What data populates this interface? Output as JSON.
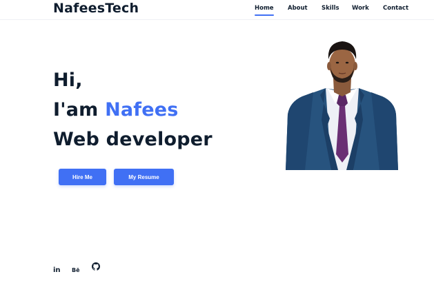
{
  "brand": {
    "logo_text": "NafeesTech"
  },
  "nav": {
    "items": [
      {
        "label": "Home",
        "active": true
      },
      {
        "label": "About",
        "active": false
      },
      {
        "label": "Skills",
        "active": false
      },
      {
        "label": "Work",
        "active": false
      },
      {
        "label": "Contact",
        "active": false
      }
    ]
  },
  "hero": {
    "greeting": "Hi,",
    "intro_prefix": "I'am ",
    "name": "Nafees",
    "role": "Web developer"
  },
  "buttons": {
    "hire": "Hire Me",
    "resume": "My Resume"
  },
  "social": {
    "linkedin": "in",
    "behance": "Bē",
    "github": "github-icon"
  },
  "colors": {
    "accent": "#4070f4",
    "text": "#0f1d2e",
    "suit": "#27537e",
    "tie": "#6a2f74"
  }
}
